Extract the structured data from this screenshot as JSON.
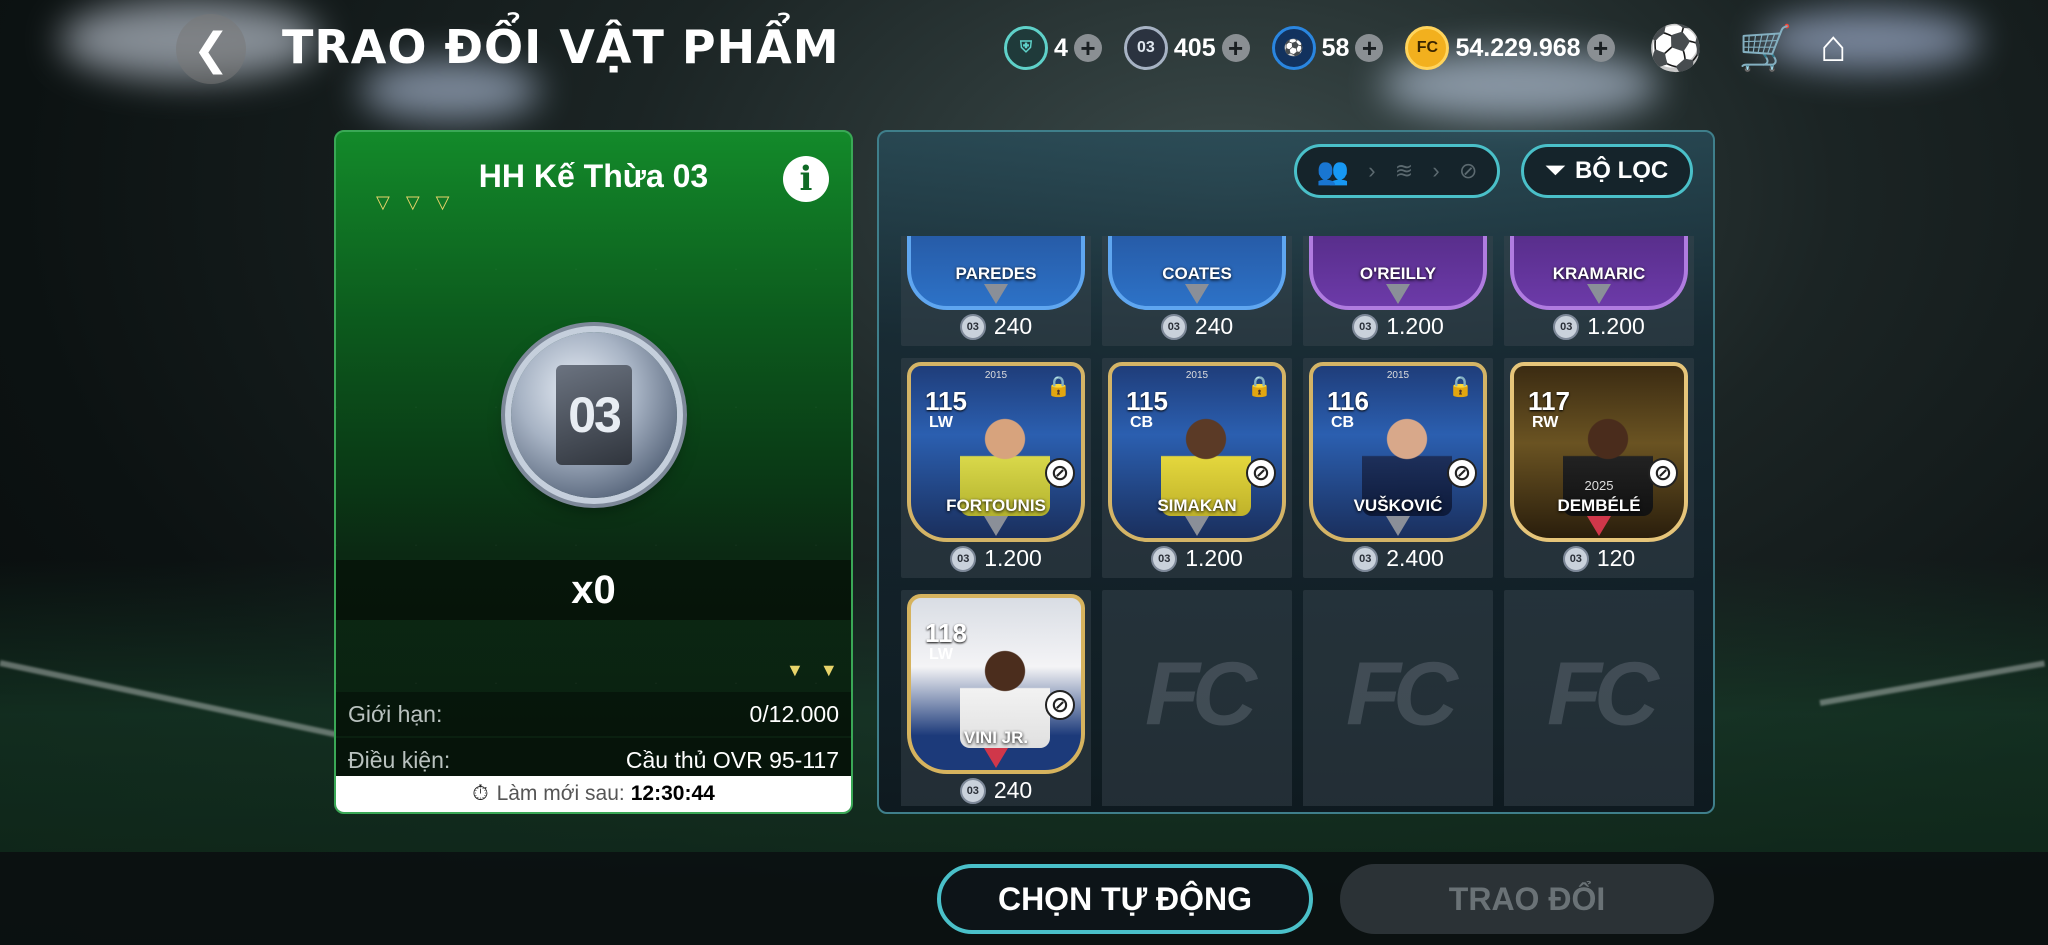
{
  "header": {
    "title": "TRAO ĐỔI VẬT PHẨM",
    "back_glyph": "❮",
    "currencies": [
      {
        "icon": "shield-token-icon",
        "value": "4",
        "color": "#5fd1c9"
      },
      {
        "icon": "03-token-icon",
        "value": "405",
        "color": "#a7b3c4"
      },
      {
        "icon": "player-token-icon",
        "value": "58",
        "color": "#2a86e0"
      },
      {
        "icon": "fc-coin-icon",
        "value": "54.229.968",
        "color": "#f2b01e"
      }
    ],
    "plus_glyph": "+"
  },
  "left_panel": {
    "title": "HH Kế Thừa 03",
    "token_label": "03",
    "quantity": "x0",
    "limit_label": "Giới hạn:",
    "limit_value": "0/12.000",
    "condition_label": "Điều kiện:",
    "condition_value": "Cầu thủ OVR 95-117",
    "refresh_label": "Làm mới sau:",
    "refresh_time": "12:30:44"
  },
  "right_panel": {
    "filter_label": "BỘ LỌC",
    "top_row": [
      {
        "name": "PAREDES",
        "price": "240",
        "style": "blueedge"
      },
      {
        "name": "COATES",
        "price": "240",
        "style": "blueedge"
      },
      {
        "name": "O'REILLY",
        "price": "1.200",
        "style": "purple"
      },
      {
        "name": "KRAMARIC",
        "price": "1.200",
        "style": "purple"
      }
    ],
    "mid_row": [
      {
        "ovr": "115",
        "pos": "LW",
        "name": "FORTOUNIS",
        "price": "1.200",
        "year": "2015"
      },
      {
        "ovr": "115",
        "pos": "CB",
        "name": "SIMAKAN",
        "price": "1.200",
        "year": "2015"
      },
      {
        "ovr": "116",
        "pos": "CB",
        "name": "VUŠKOVIĆ",
        "price": "2.400",
        "year": "2015"
      },
      {
        "ovr": "117",
        "pos": "RW",
        "name": "DEMBÉLÉ",
        "price": "120",
        "year": "2025"
      }
    ],
    "bottom_row": [
      {
        "ovr": "118",
        "pos": "LW",
        "name": "VINI JR.",
        "price": "240"
      }
    ],
    "empty_slot_logo": "FC",
    "coin_label": "03"
  },
  "footer": {
    "auto_label": "CHỌN TỰ ĐỘNG",
    "trade_label": "TRAO ĐỔI"
  }
}
